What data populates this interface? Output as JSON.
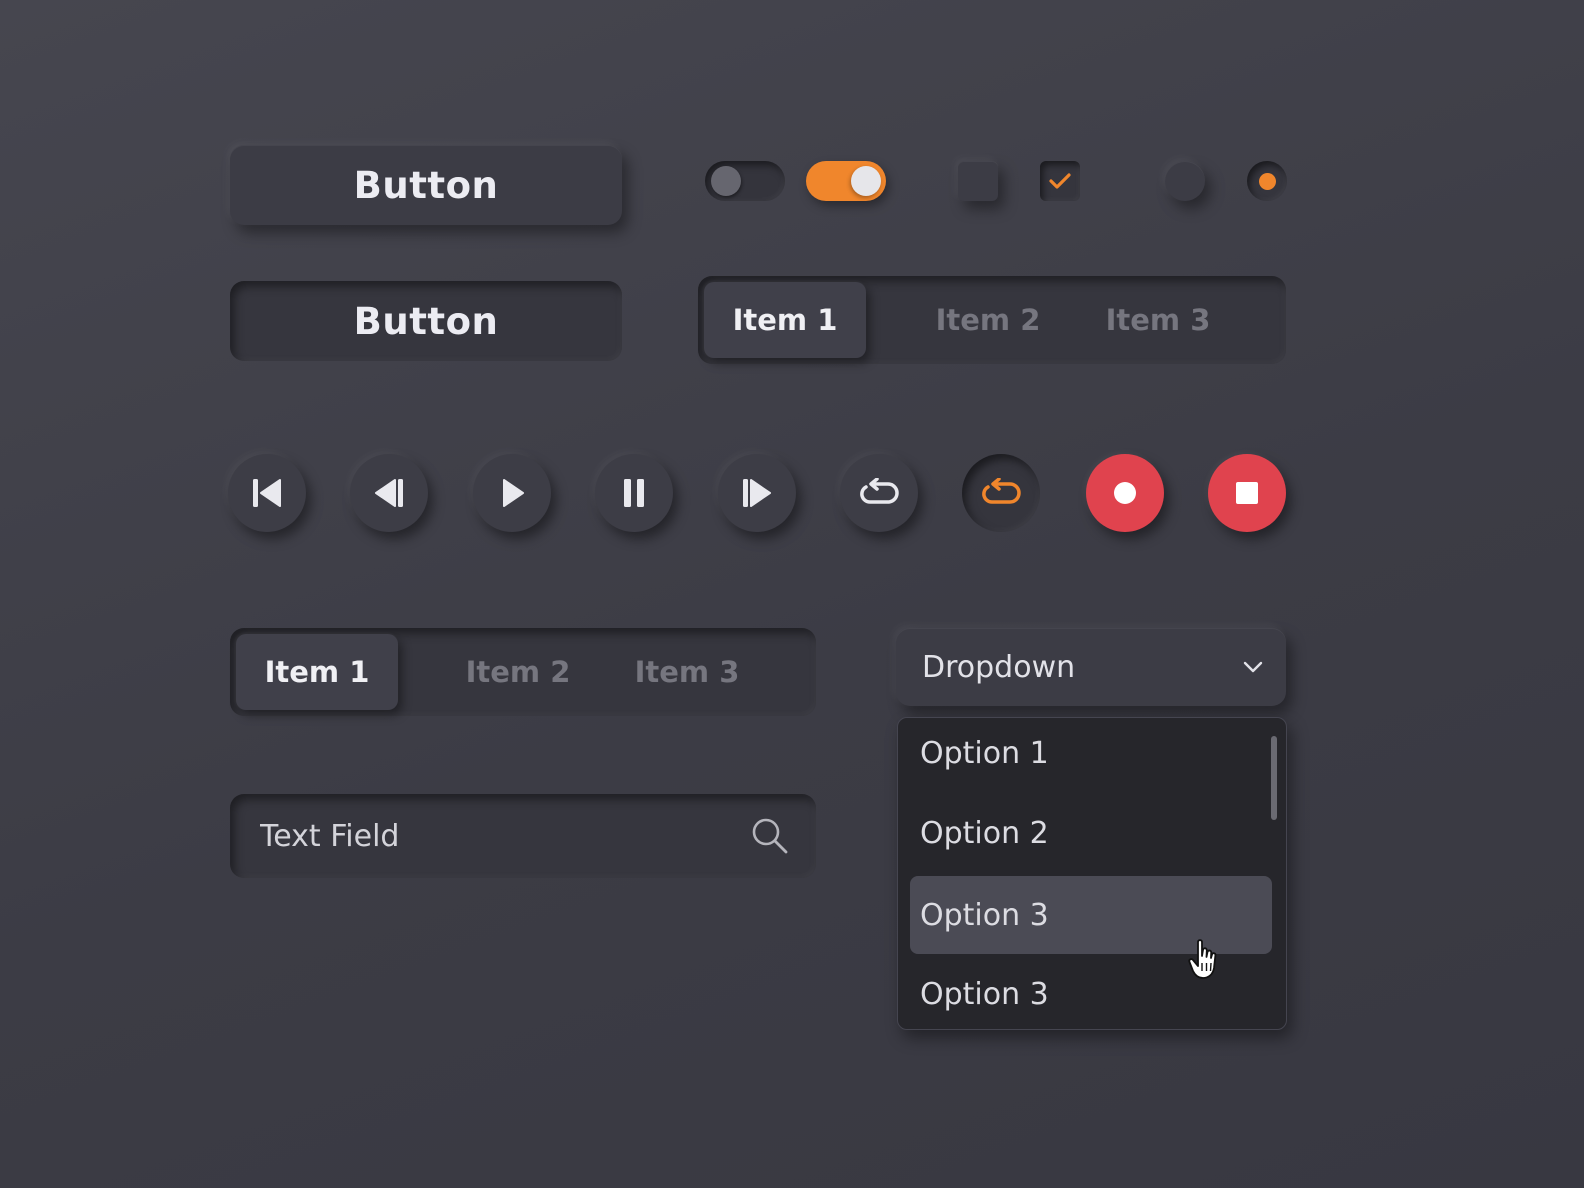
{
  "buttons": {
    "primary_label": "Button",
    "secondary_label": "Button"
  },
  "toggles": [
    {
      "state": "off"
    },
    {
      "state": "on"
    }
  ],
  "checkboxes": [
    {
      "checked": false
    },
    {
      "checked": true
    }
  ],
  "radios": [
    {
      "selected": false
    },
    {
      "selected": true
    }
  ],
  "segmented_top": {
    "items": [
      "Item 1",
      "Item 2",
      "Item 3"
    ],
    "selected": "Item 1"
  },
  "segmented_bottom": {
    "items": [
      "Item 1",
      "Item 2",
      "Item 3"
    ],
    "selected": "Item 1"
  },
  "media_controls": [
    {
      "icon": "skip-to-start-icon"
    },
    {
      "icon": "step-back-icon"
    },
    {
      "icon": "play-icon"
    },
    {
      "icon": "pause-icon"
    },
    {
      "icon": "step-forward-icon"
    },
    {
      "icon": "repeat-icon"
    },
    {
      "icon": "repeat-active-icon",
      "active": true
    },
    {
      "icon": "record-icon"
    },
    {
      "icon": "stop-icon"
    }
  ],
  "text_field": {
    "placeholder": "Text Field",
    "icon": "search-icon"
  },
  "dropdown": {
    "label": "Dropdown",
    "icon": "chevron-down-icon",
    "options": [
      "Option 1",
      "Option 2",
      "Option 3",
      "Option 3"
    ],
    "highlighted_index": 2
  },
  "colors": {
    "accent": "#f0862c",
    "danger": "#e0434e",
    "background": "#3f3f48"
  }
}
